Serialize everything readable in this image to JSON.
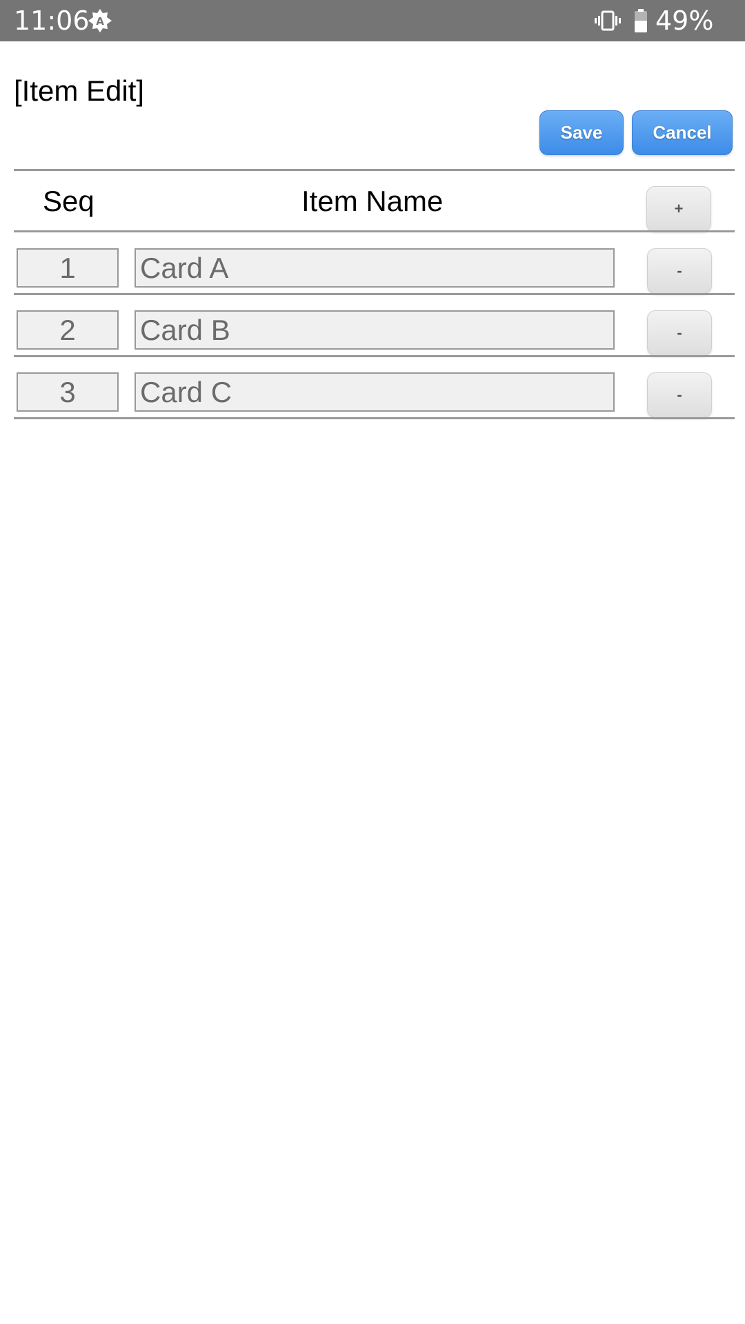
{
  "status_bar": {
    "time": "11:06",
    "auto_brightness_icon": "auto-brightness-icon",
    "vibrate_icon": "vibrate-icon",
    "battery_icon": "battery-icon",
    "battery_percent": "49%"
  },
  "page": {
    "title": "[Item Edit]"
  },
  "toolbar": {
    "save_label": "Save",
    "cancel_label": "Cancel",
    "accent_color": "#4a97ec"
  },
  "table": {
    "headers": {
      "seq": "Seq",
      "item_name": "Item Name",
      "add_label": "+"
    },
    "rows": [
      {
        "seq": "1",
        "name": "Card A",
        "remove_label": "-"
      },
      {
        "seq": "2",
        "name": "Card B",
        "remove_label": "-"
      },
      {
        "seq": "3",
        "name": "Card C",
        "remove_label": "-"
      }
    ]
  }
}
